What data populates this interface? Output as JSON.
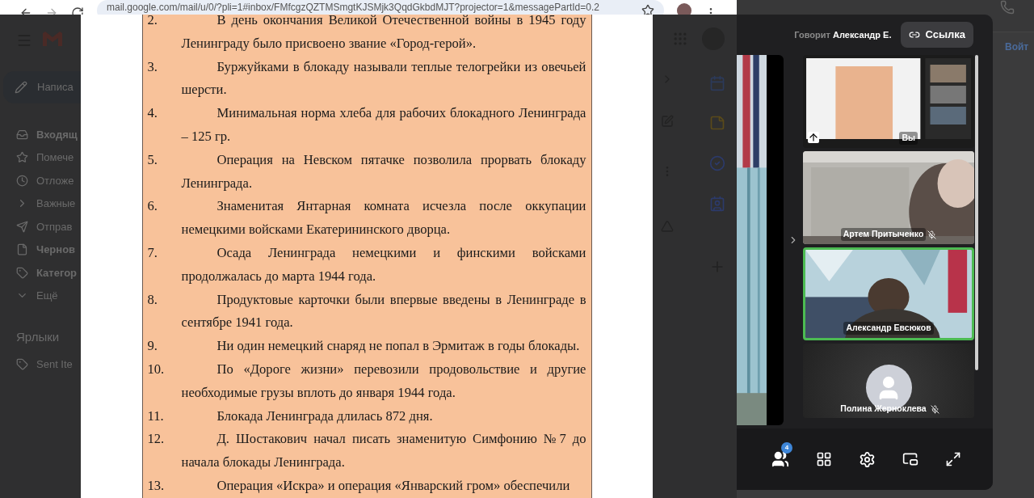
{
  "browser": {
    "url": "mail.google.com/mail/u/0/?pli=1#inbox/FMfcgzQZTMSmgtKJSMjk3QqdGkbdMJT?projector=1&messagePartId=0.2"
  },
  "gmail": {
    "compose": "Написа",
    "folders": [
      {
        "label": "Входящ",
        "unread": true
      },
      {
        "label": "Помече",
        "unread": false
      },
      {
        "label": "Отложе",
        "unread": false
      },
      {
        "label": "Важные",
        "unread": false
      },
      {
        "label": "Отправ",
        "unread": false
      },
      {
        "label": "Чернов",
        "unread": true
      },
      {
        "label": "Категор",
        "unread": true
      },
      {
        "label": "Ещё",
        "unread": false
      }
    ],
    "labels_heading": "Ярлыки",
    "labels": [
      "Sent Ite"
    ]
  },
  "document": {
    "items": [
      {
        "number": "2.",
        "text": "В день окончания Великой Отечественной войны в 1945 году Ленинграду было присвоено звание «Город-герой»."
      },
      {
        "number": "3.",
        "text": "Буржуйками в блокаду называли теплые телогрейки из овечьей шерсти."
      },
      {
        "number": "4.",
        "text": "Минимальная норма хлеба для рабочих блокадного Ленинграда – 125 гр."
      },
      {
        "number": "5.",
        "text": "Операция на Невском пятачке позволила прорвать блокаду Ленинграда."
      },
      {
        "number": "6.",
        "text": "Знаменитая Янтарная комната исчезла после оккупации немецкими войсками Екатерининского дворца."
      },
      {
        "number": "7.",
        "text": "Осада Ленинграда немецкими и финскими войсками продолжалась до марта 1944 года."
      },
      {
        "number": "8.",
        "text": "Продуктовые карточки были впервые введены в Ленинграде в сентябре 1941 года."
      },
      {
        "number": "9.",
        "text": "Ни один немецкий снаряд не попал в Эрмитаж в годы блокады."
      },
      {
        "number": "10.",
        "text": "По «Дороге жизни» перевозили продовольствие и другие необходимые грузы вплоть до января 1944 года."
      },
      {
        "number": "11.",
        "text": "Блокада Ленинграда длилась 872 дня."
      },
      {
        "number": "12.",
        "text": "Д. Шостакович начал писать знаменитую Симфонию №7 до начала блокады Ленинграда."
      },
      {
        "number": "13.",
        "text": "Операция «Искра» и операция «Январский гром» обеспечили"
      }
    ]
  },
  "meet": {
    "speaking_label": "Говорит",
    "speaker": "Александр Е.",
    "link_button": "Ссылка",
    "tiles": [
      {
        "kind": "screen",
        "name": "Вы",
        "muted": false,
        "speaking": false
      },
      {
        "kind": "video",
        "name": "Артем Притыченко",
        "muted": true,
        "speaking": false
      },
      {
        "kind": "video",
        "name": "Александр Евсюков",
        "muted": false,
        "speaking": true
      },
      {
        "kind": "avatar",
        "name": "Полина Жерноклева",
        "muted": true,
        "speaking": false
      }
    ],
    "participants_count": "4"
  },
  "desktop": {
    "login": "Войт"
  }
}
